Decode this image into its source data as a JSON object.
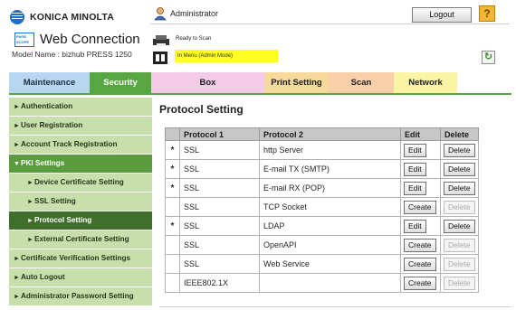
{
  "brand": {
    "company": "KONICA MINOLTA",
    "product": "Web Connection",
    "badge": "PAGE SCOPE"
  },
  "model_label": "Model Name : bizhub PRESS 1250",
  "header": {
    "user": "Administrator",
    "logout_label": "Logout",
    "help_label": "?",
    "status_ready": "Ready to Scan",
    "status_mode": "In Menu (Admin Mode)",
    "colors": {
      "mode_bar": "#ffff22",
      "help": "#f2b630"
    }
  },
  "tabs": [
    {
      "label": "Maintenance"
    },
    {
      "label": "Security"
    },
    {
      "label": "Box"
    },
    {
      "label": "Print Setting"
    },
    {
      "label": "Scan"
    },
    {
      "label": "Network"
    }
  ],
  "active_tab": "Security",
  "sidebar": {
    "items": [
      {
        "label": "Authentication"
      },
      {
        "label": "User Registration"
      },
      {
        "label": "Account Track Registration"
      },
      {
        "label": "PKI Settings"
      },
      {
        "label": "Device Certificate Setting"
      },
      {
        "label": "SSL Setting"
      },
      {
        "label": "Protocol Setting"
      },
      {
        "label": "External Certificate Setting"
      },
      {
        "label": "Certificate Verification Settings"
      },
      {
        "label": "Auto Logout"
      },
      {
        "label": "Administrator Password Setting"
      }
    ],
    "arrow_right": "►",
    "arrow_down": "▼"
  },
  "main": {
    "title": "Protocol Setting",
    "columns": {
      "mark": "",
      "protocol1": "Protocol 1",
      "protocol2": "Protocol 2",
      "edit": "Edit",
      "delete": "Delete"
    },
    "rows": [
      {
        "mark": "*",
        "protocol1": "SSL",
        "protocol2": "http Server",
        "edit": "Edit",
        "delete": "Delete"
      },
      {
        "mark": "*",
        "protocol1": "SSL",
        "protocol2": "E-mail TX (SMTP)",
        "edit": "Edit",
        "delete": "Delete"
      },
      {
        "mark": "*",
        "protocol1": "SSL",
        "protocol2": "E-mail RX (POP)",
        "edit": "Edit",
        "delete": "Delete"
      },
      {
        "mark": "",
        "protocol1": "SSL",
        "protocol2": "TCP Socket",
        "edit": "Create",
        "delete": "Delete"
      },
      {
        "mark": "*",
        "protocol1": "SSL",
        "protocol2": "LDAP",
        "edit": "Edit",
        "delete": "Delete"
      },
      {
        "mark": "",
        "protocol1": "SSL",
        "protocol2": "OpenAPI",
        "edit": "Create",
        "delete": "Delete"
      },
      {
        "mark": "",
        "protocol1": "SSL",
        "protocol2": "Web Service",
        "edit": "Create",
        "delete": "Delete"
      },
      {
        "mark": "",
        "protocol1": "IEEE802.1X",
        "protocol2": "",
        "edit": "Create",
        "delete": "Delete"
      }
    ]
  }
}
